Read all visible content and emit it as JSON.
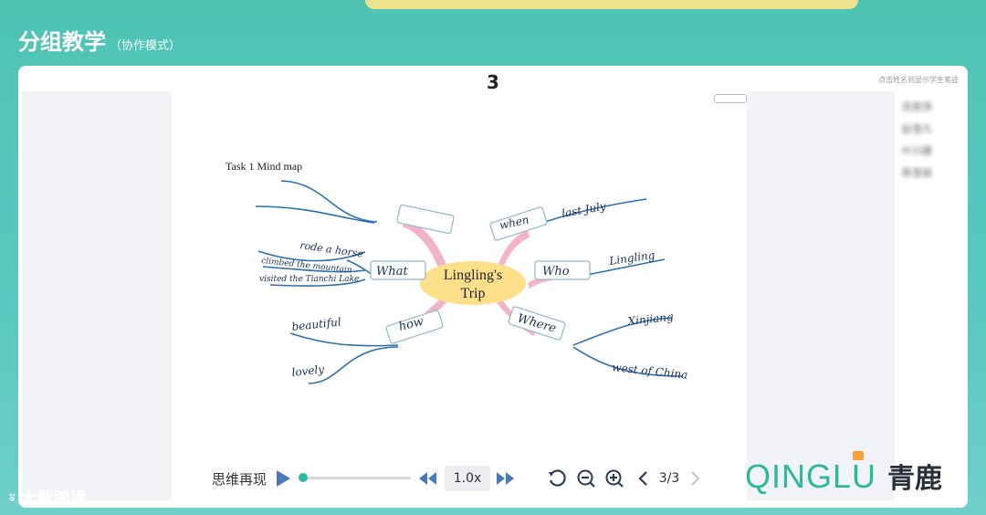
{
  "window": {
    "title": "分组教学",
    "mode": "（协作模式）"
  },
  "panel": {
    "group_number": "3",
    "hint": "点击姓名则显示学生笔迹"
  },
  "students": [
    "范思萍",
    "赵雪凡",
    "叶兴娜",
    "陈雪丽"
  ],
  "mindmap": {
    "task_title": "Task 1 Mind map",
    "center": [
      "Lingling's",
      "Trip"
    ],
    "branch_what": "What",
    "branch_when": "when",
    "branch_who": "Who",
    "branch_how": "how",
    "branch_where": "Where",
    "what_1": "rode a horse",
    "what_2": "climbed the mountain",
    "what_3": "visited the Tianchi Lake",
    "when_1": "last July",
    "who_1": "Lingling",
    "how_1": "beautiful",
    "how_2": "lovely",
    "where_1": "Xinjiang",
    "where_2": "west of China"
  },
  "controls": {
    "replay_label": "思维再现",
    "progress": 0.0,
    "speed": "1.0x",
    "page": "3/3"
  },
  "brand": {
    "latin": "QINGLU",
    "cn": "青鹿"
  },
  "watermark": "大数跨境",
  "colors": {
    "accent": "#2dbba4",
    "header_bg": "#4fc4b3",
    "center_node": "#ffe08a",
    "branch_pink": "#f2a7be",
    "ink_blue": "#2e6fb0"
  }
}
